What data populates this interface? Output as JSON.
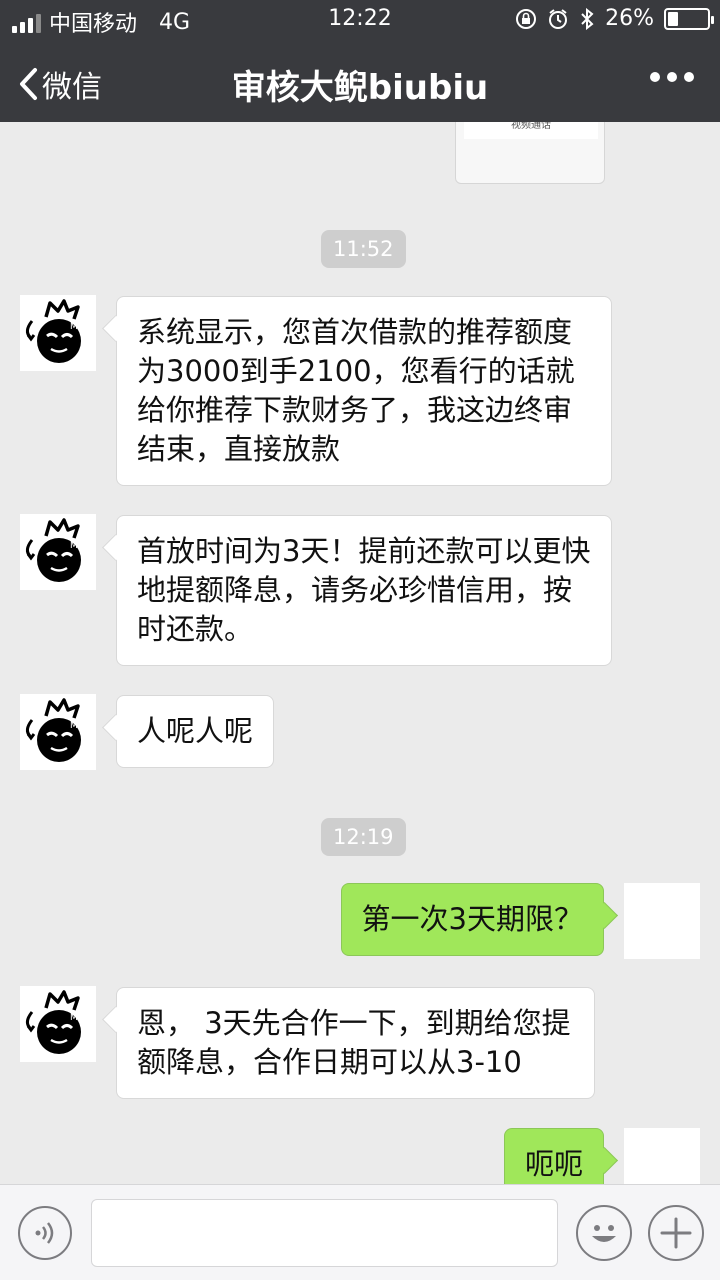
{
  "status_bar": {
    "carrier": "中国移动",
    "network": "4G",
    "time": "12:22",
    "battery_percent": "26%",
    "battery_level": 0.26
  },
  "nav": {
    "back_label": "微信",
    "title": "审核大鲵biubiu"
  },
  "previous_card": {
    "label": "视频通话"
  },
  "timestamps": [
    "11:52",
    "12:19"
  ],
  "messages": [
    {
      "side": "in",
      "text": "系统显示，您首次借款的推荐额度为3000到手2100，您看行的话就给你推荐下款财务了，我这边终审结束，直接放款"
    },
    {
      "side": "in",
      "text": "首放时间为3天！提前还款可以更快地提额降息，请务必珍惜信用，按时还款。"
    },
    {
      "side": "in",
      "text": "人呢人呢"
    },
    {
      "side": "out",
      "text": "第一次3天期限？"
    },
    {
      "side": "in",
      "text": "恩， 3天先合作一下，到期给您提额降息，合作日期可以从3-10"
    },
    {
      "side": "out",
      "text": "呃呃"
    }
  ],
  "input": {
    "placeholder": ""
  },
  "icons": {
    "back": "chevron-left-icon",
    "more": "more-dots-icon",
    "voice": "voice-icon",
    "emoji": "emoji-icon",
    "plus": "plus-icon"
  },
  "colors": {
    "header_bg": "#393a3e",
    "chat_bg": "#ebebeb",
    "outgoing_bubble": "#a0e75a",
    "incoming_bubble": "#ffffff"
  }
}
